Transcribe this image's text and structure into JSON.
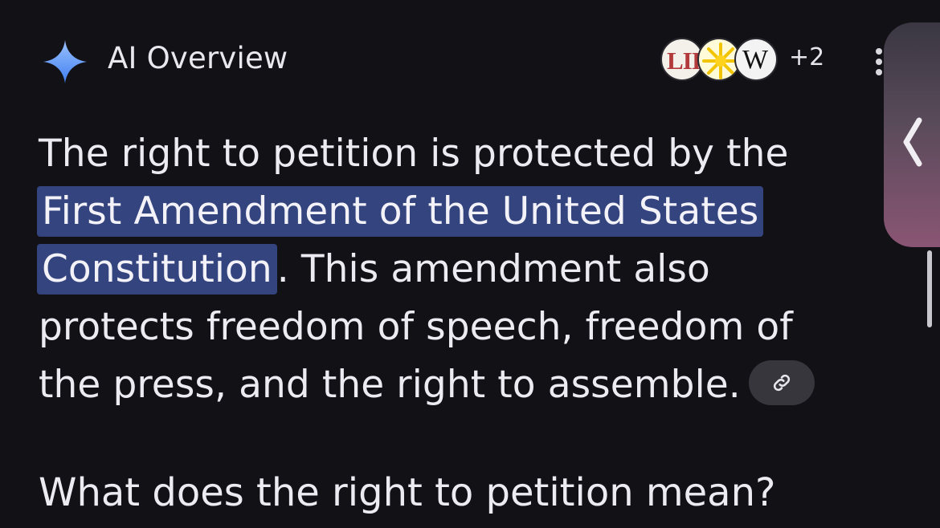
{
  "header": {
    "title": "AI Overview",
    "sparkle_icon": "sparkle-icon",
    "sources": {
      "lii_logo_text": "LII",
      "wiki_logo_text": "W",
      "more_count": "+2"
    },
    "menu_icon": "more-vert-icon"
  },
  "answer": {
    "text_before": "The right to petition is protected by the ",
    "highlight": "First Amendment of the United States Constitution",
    "text_after": ". This amendment also protects freedom of speech, freedom of the press, and the right to assemble.",
    "link_icon": "link-icon"
  },
  "followup": {
    "question": "What does the right to petition mean?"
  },
  "side_panel": {
    "icon": "chevron-left-icon"
  },
  "colors": {
    "background": "#121116",
    "highlight": "#34447E",
    "sparkle_top": "#8AB4F8",
    "sparkle_bottom": "#4285F4"
  }
}
